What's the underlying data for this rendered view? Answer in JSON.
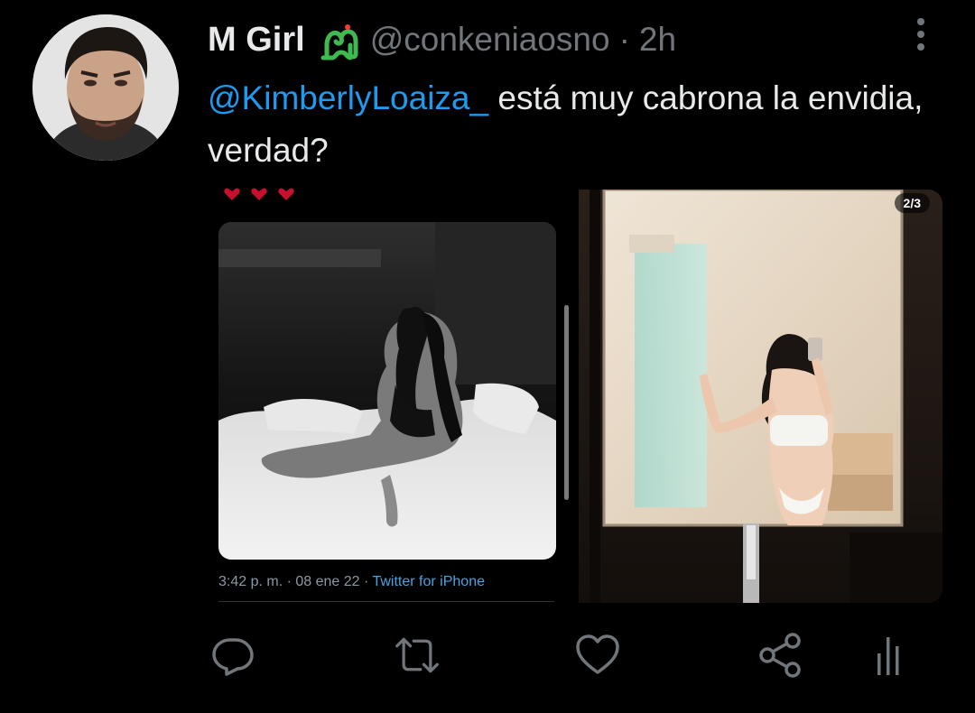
{
  "tweet": {
    "display_name": "M Girl",
    "badge_icon": "snake-icon",
    "handle": "@conkeniaosno",
    "separator": "·",
    "time": "2h",
    "mention": "@KimberlyLoaiza_",
    "text": " está muy cabrona la envidia, verdad?"
  },
  "media": {
    "left": {
      "hearts": [
        "heart-icon",
        "heart-icon",
        "heart-icon"
      ],
      "timestamp": "3:42 p. m. · 08 ene 22 · ",
      "source": "Twitter for iPhone"
    },
    "right": {
      "counter": "2/3"
    }
  },
  "actions": {
    "reply_icon": "reply-icon",
    "retweet_icon": "retweet-icon",
    "like_icon": "heart-icon",
    "share_icon": "share-icon",
    "analytics_icon": "analytics-icon"
  },
  "colors": {
    "background": "#000000",
    "text": "#e7e9ea",
    "muted": "#71767b",
    "link": "#1d9bf0",
    "badge": "#3fb950"
  }
}
